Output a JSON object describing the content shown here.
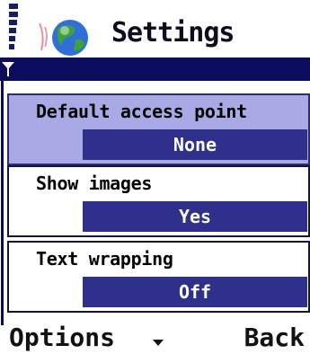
{
  "header": {
    "title": "Settings"
  },
  "settings": [
    {
      "label": "Default access point",
      "value": "None",
      "selected": true
    },
    {
      "label": "Show images",
      "value": "Yes",
      "selected": false
    },
    {
      "label": "Text wrapping",
      "value": "Off",
      "selected": false
    }
  ],
  "softkeys": {
    "left": "Options",
    "right": "Back"
  },
  "colors": {
    "header_bar": "#0c0c5c",
    "selection": "#a9a9e6",
    "value_box": "#2f2f8c"
  },
  "icons": [
    "signal-strength-icon",
    "globe-icon",
    "antenna-icon",
    "chevron-down-icon"
  ]
}
